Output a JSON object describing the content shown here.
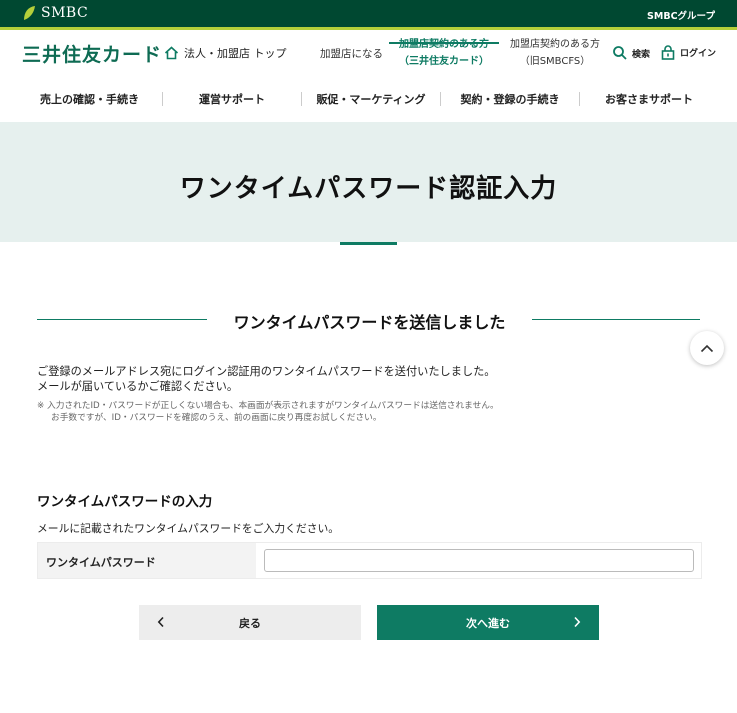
{
  "topbar": {
    "logo_text": "SMBC",
    "group_text": "SMBCグループ"
  },
  "header": {
    "brand": "三井住友カード",
    "home_link": "法人・加盟店 トップ",
    "nav_become_merchant": "加盟店になる",
    "nav_contracted_line1": "加盟店契約のある方",
    "nav_contracted_line2": "（三井住友カード）",
    "nav_former_line1": "加盟店契約のある方",
    "nav_former_line2": "（旧SMBCFS）",
    "search_label": "検索",
    "login_label": "ログイン"
  },
  "global_nav": [
    {
      "label": "売上の確認・手続き"
    },
    {
      "label": "運営サポート"
    },
    {
      "label": "販促・マーケティング"
    },
    {
      "label": "契約・登録の手続き"
    },
    {
      "label": "お客さまサポート"
    }
  ],
  "hero": {
    "title": "ワンタイムパスワード認証入力"
  },
  "section": {
    "title": "ワンタイムパスワードを送信しました",
    "message_line1": "ご登録のメールアドレス宛にログイン認証用のワンタイムパスワードを送付いたしました。",
    "message_line2": "メールが届いているかご確認ください。",
    "note_line1": "※  入力されたID・パスワードが正しくない場合も、本画面が表示されますがワンタイムパスワードは送信されません。",
    "note_line2": "お手数ですが、ID・パスワードを確認のうえ、前の画面に戻り再度お試しください。"
  },
  "form": {
    "title": "ワンタイムパスワードの入力",
    "description": "メールに記載されたワンタイムパスワードをご入力ください。",
    "field_label": "ワンタイムパスワード",
    "field_value": ""
  },
  "buttons": {
    "back_label": "戻る",
    "next_label": "次へ進む"
  },
  "colors": {
    "brand_dark": "#004831",
    "accent_green": "#0e7b63",
    "lime": "#b4cf3a",
    "hero_bg": "#e6f0ee"
  }
}
